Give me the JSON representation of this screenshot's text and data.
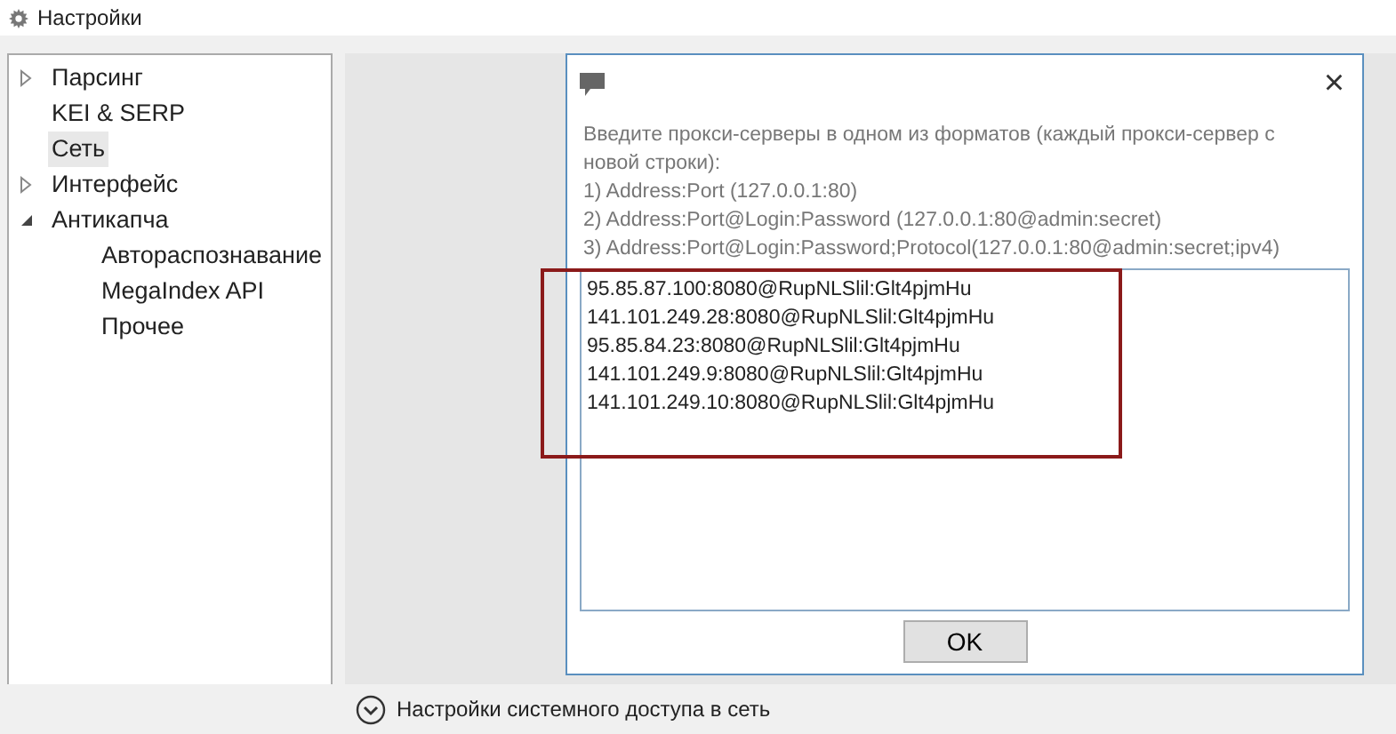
{
  "window": {
    "title": "Настройки"
  },
  "tree": [
    {
      "label": "Парсинг",
      "selected": false,
      "expanded": false
    },
    {
      "label": "KEI & SERP",
      "selected": false
    },
    {
      "label": "Сеть",
      "selected": true
    },
    {
      "label": "Интерфейс",
      "selected": false,
      "expanded": false
    },
    {
      "label": "Антикапча",
      "selected": false,
      "expanded": true,
      "children": [
        {
          "label": "Автораспознавание",
          "selected": false
        },
        {
          "label": "MegaIndex API",
          "selected": false
        },
        {
          "label": "Прочее",
          "selected": false
        }
      ]
    }
  ],
  "dialog": {
    "close": "×",
    "instructions": [
      "Введите прокси-серверы в одном из форматов (каждый прокси-сервер с новой строки):",
      "1) Address:Port (127.0.0.1:80)",
      "2) Address:Port@Login:Password (127.0.0.1:80@admin:secret)",
      "3) Address:Port@Login:Password;Protocol(127.0.0.1:80@admin:secret;ipv4)"
    ],
    "proxies": [
      "95.85.87.100:8080@RupNLSlil:Glt4pjmHu",
      "141.101.249.28:8080@RupNLSlil:Glt4pjmHu",
      "95.85.84.23:8080@RupNLSlil:Glt4pjmHu",
      "141.101.249.9:8080@RupNLSlil:Glt4pjmHu",
      "141.101.249.10:8080@RupNLSlil:Glt4pjmHu"
    ],
    "highlighted": true,
    "ok_button": "OK"
  },
  "footer": {
    "label": "Настройки системного доступа в сеть",
    "expanded": false
  }
}
